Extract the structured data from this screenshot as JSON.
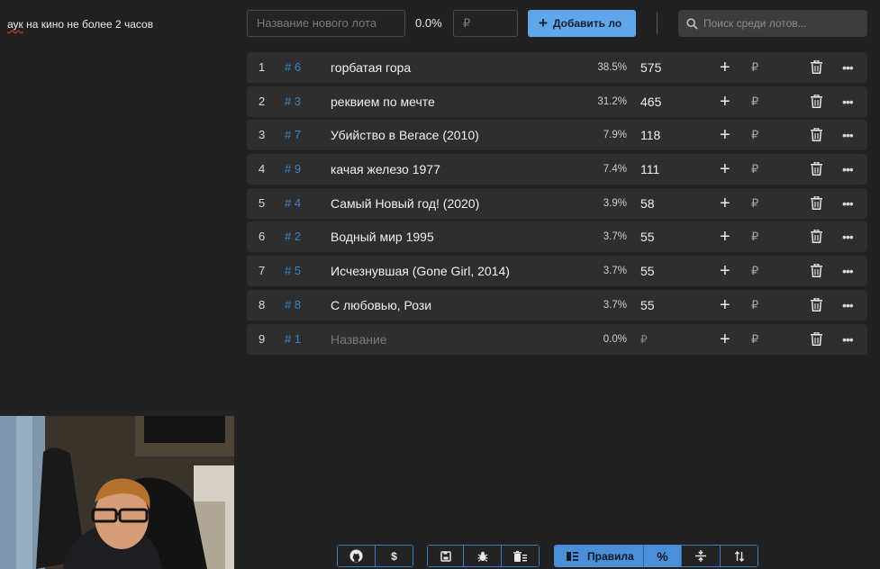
{
  "note": {
    "prefix": "аук",
    "rest": " на кино не более 2 часов"
  },
  "toolbar": {
    "new_lot_placeholder": "Название нового лота",
    "percent": "0.0%",
    "amount_placeholder": "₽",
    "add_label": "Добавить ло",
    "search_placeholder": "Поиск среди лотов..."
  },
  "currency": "₽",
  "lots": [
    {
      "rank": "1",
      "id": "# 6",
      "name": "горбатая гора",
      "percent": "38.5%",
      "amount": "575"
    },
    {
      "rank": "2",
      "id": "# 3",
      "name": "реквием по мечте",
      "percent": "31.2%",
      "amount": "465"
    },
    {
      "rank": "3",
      "id": "# 7",
      "name": "Убийство в Вегасе (2010)",
      "percent": "7.9%",
      "amount": "118"
    },
    {
      "rank": "4",
      "id": "# 9",
      "name": "качая железо 1977",
      "percent": "7.4%",
      "amount": "111"
    },
    {
      "rank": "5",
      "id": "# 4",
      "name": "Самый Новый год! (2020)",
      "percent": "3.9%",
      "amount": "58"
    },
    {
      "rank": "6",
      "id": "# 2",
      "name": "Водный мир 1995",
      "percent": "3.7%",
      "amount": "55"
    },
    {
      "rank": "7",
      "id": "# 5",
      "name": "Исчезнувшая (Gone Girl, 2014)",
      "percent": "3.7%",
      "amount": "55"
    },
    {
      "rank": "8",
      "id": "# 8",
      "name": "С любовью, Рози",
      "percent": "3.7%",
      "amount": "55"
    },
    {
      "rank": "9",
      "id": "# 1",
      "name": "Название",
      "percent": "0.0%",
      "amount": "₽",
      "placeholder": true
    }
  ],
  "bottom": {
    "rules_label": "Правила",
    "percent_symbol": "%",
    "dollar": "$"
  },
  "colors": {
    "accent": "#5fa6ea",
    "id_blue": "#3d85c6",
    "background": "#212121",
    "row": "#2e2e2e"
  }
}
